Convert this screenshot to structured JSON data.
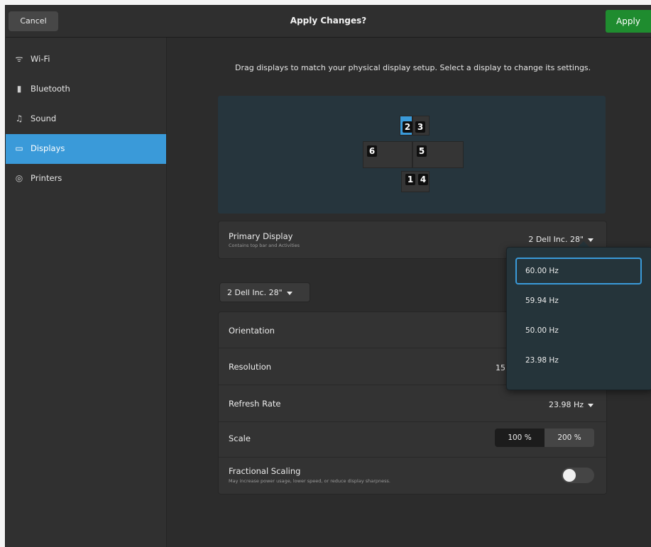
{
  "header": {
    "title": "Apply Changes?",
    "cancel_label": "Cancel",
    "apply_label": "Apply"
  },
  "sidebar": {
    "items": [
      {
        "label": "Wi-Fi",
        "icon": "wifi-icon",
        "glyph": "ᯤ"
      },
      {
        "label": "Bluetooth",
        "icon": "bluetooth-icon",
        "glyph": "▮"
      },
      {
        "label": "Sound",
        "icon": "music-note-icon",
        "glyph": "♫"
      },
      {
        "label": "Displays",
        "icon": "display-icon",
        "glyph": "▭"
      },
      {
        "label": "Printers",
        "icon": "printer-icon",
        "glyph": "◎"
      }
    ],
    "active_index": 3
  },
  "displays": {
    "instructions": "Drag displays to match your physical display setup. Select a display to change its settings.",
    "arrangement": {
      "monitors": [
        "2",
        "3",
        "6",
        "5",
        "1",
        "4"
      ]
    },
    "primary": {
      "label": "Primary Display",
      "sublabel": "Contains top bar and Activities",
      "value": "2   Dell Inc. 28\""
    },
    "selected_monitor_button": "2   Dell Inc. 28\"",
    "settings": {
      "orientation_label": "Orientation",
      "resolution_label": "Resolution",
      "resolution_value_partial": "15",
      "refresh_label": "Refresh Rate",
      "refresh_value": "23.98 Hz",
      "scale_label": "Scale",
      "scale_options": [
        "100 %",
        "200 %"
      ],
      "scale_selected": "100 %",
      "fractional_label": "Fractional Scaling",
      "fractional_sublabel": "May increase power usage, lower speed, or reduce display sharpness.",
      "fractional_enabled": false
    },
    "refresh_popover": {
      "options": [
        "60.00 Hz",
        "59.94 Hz",
        "50.00 Hz",
        "23.98 Hz"
      ],
      "focused": "60.00 Hz"
    }
  },
  "colors": {
    "accent": "#3a9ad9",
    "apply_green": "#1f8c2f",
    "arrangement_bg": "#26353d"
  }
}
